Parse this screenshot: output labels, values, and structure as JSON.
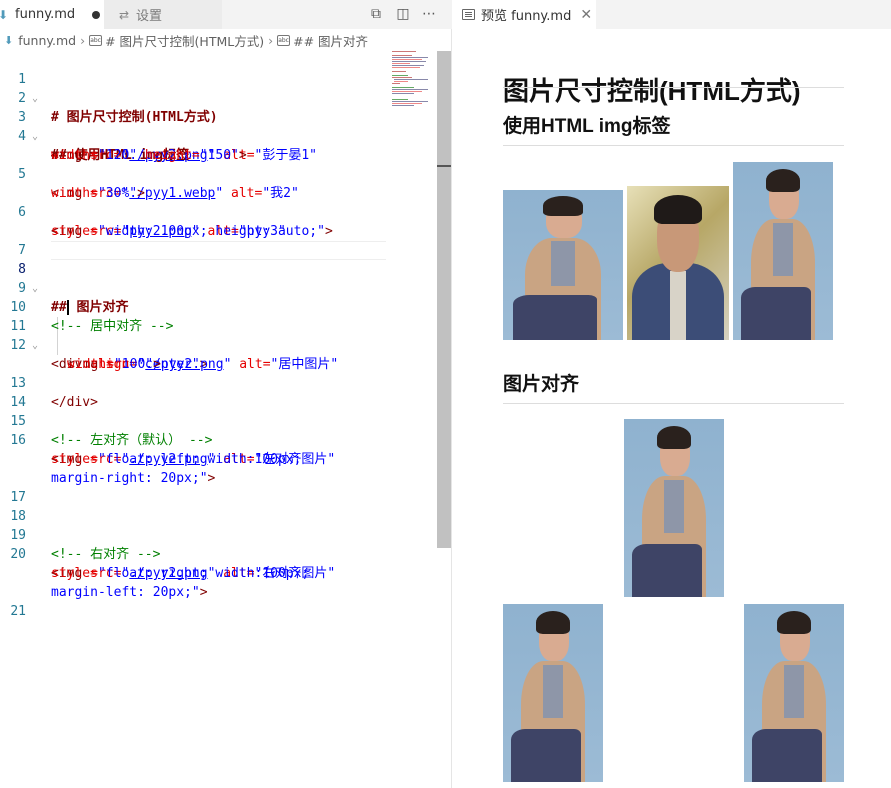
{
  "editor": {
    "tabs": [
      {
        "label": "funny.md",
        "icon": "markdown-file-icon",
        "dirty": true
      },
      {
        "label": "设置",
        "icon": "settings-icon"
      }
    ],
    "toolbar_icons": [
      "open-preview-icon",
      "split-editor-icon",
      "more-actions-icon"
    ],
    "breadcrumb": [
      "funny.md",
      "# 图片尺寸控制(HTML方式)",
      "## 图片对齐"
    ],
    "line_numbers": [
      "1",
      "2",
      "3",
      "4",
      "5",
      "6",
      "7",
      "8",
      "9",
      "10",
      "11",
      "12",
      "13",
      "14",
      "15",
      "16",
      "17",
      "18",
      "19",
      "20",
      "21"
    ],
    "current_line": "8",
    "code": {
      "l1": "# 图片尺寸控制(HTML方式)",
      "l3": "## 使用HTML img标签",
      "l4a_tag": "<img",
      "l4a_src_attr": " src=",
      "l4a_src_q1": "\"",
      "l4a_src": "./pyy2.png",
      "l4a_src_q2": "\"",
      "l4a_alt_attr": " alt=",
      "l4a_alt": "\"彭于晏1\"",
      "l4b_w_attr": "width=",
      "l4b_w": "\"120\"",
      "l4b_h_attr": " height=",
      "l4b_h": "\"150\"",
      "l4b_close": ">",
      "l5a_tag": "<img",
      "l5a_src_attr": " src=",
      "l5a_src_q1": "\"",
      "l5a_src": "./pyy1.webp",
      "l5a_src_q2": "\"",
      "l5a_alt_attr": " alt=",
      "l5a_alt": "\"我2\"",
      "l5b_w_attr": "width=",
      "l5b_w": "\"30%\"",
      "l5b_close": ">",
      "l6a_tag": "<img",
      "l6a_src_attr": " src=",
      "l6a_src_q1": "\"",
      "l6a_src": "pyy2.png",
      "l6a_src_q2": "\"",
      "l6a_alt_attr": " alt=",
      "l6a_alt": "\"pyy3\"",
      "l6b_style_attr": "style=",
      "l6b_style": "\"width: 100px; height: auto;\"",
      "l6b_close": ">",
      "l8_hash": "##",
      "l8_text": " 图片对齐",
      "l10": "<!-- 居中对齐 -->",
      "l11_tag": "<div",
      "l11_attr": " align=",
      "l11_val": "\"center\"",
      "l11_close": ">",
      "l12a_tag": "<img",
      "l12a_src_attr": " src=",
      "l12a_src_q1": "\"",
      "l12a_src": "./pyy2.png",
      "l12a_src_q2": "\"",
      "l12a_alt_attr": " alt=",
      "l12a_alt": "\"居中图片\"",
      "l12b_w_attr": "width=",
      "l12b_w": "\"100\"",
      "l12b_close": ">",
      "l13": "</div>",
      "l15": "<!-- 左对齐（默认） -->",
      "l16a_tag": "<img",
      "l16a_src_attr": " src=",
      "l16a_src_q1": "\"",
      "l16a_src": "./pyy2.png",
      "l16a_src_q2": "\"",
      "l16a_alt_attr": " alt=",
      "l16a_alt": "\"左对齐图片\"",
      "l16b_style_attr": "style=",
      "l16b_style": "\"float: left; width:100px;",
      "l16c_style": "margin-right: 20px;\"",
      "l16c_close": ">",
      "l19": "<!-- 右对齐 -->",
      "l20a_tag": "<img",
      "l20a_src_attr": " src=",
      "l20a_src_q1": "\"",
      "l20a_src": "./pyy2.png",
      "l20a_src_q2": "\"",
      "l20a_alt_attr": " alt=",
      "l20a_alt": "\"右对齐图片\"",
      "l20b_style_attr": "style=",
      "l20b_style": "\"float: right; width:100px;",
      "l20c_style": "margin-left: 20px;\"",
      "l20c_close": ">"
    }
  },
  "preview": {
    "tab_label": "预览 funny.md",
    "h1": "图片尺寸控制(HTML方式)",
    "h2_a": "使用HTML img标签",
    "h2_b": "图片对齐",
    "images": [
      {
        "kind": "coat-photo"
      },
      {
        "kind": "denim-photo"
      },
      {
        "kind": "coat-photo"
      },
      {
        "kind": "coat-photo"
      },
      {
        "kind": "coat-photo"
      },
      {
        "kind": "coat-photo"
      }
    ]
  },
  "colors": {
    "heading": "#800000",
    "tag": "#800000",
    "attribute": "#e50000",
    "value": "#0000ff",
    "comment": "#008000",
    "line_number": "#237893"
  }
}
